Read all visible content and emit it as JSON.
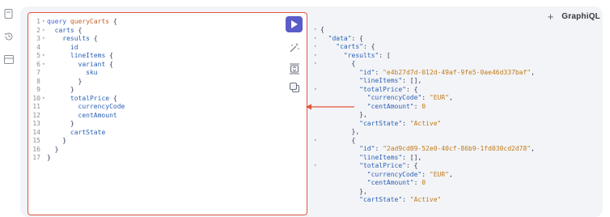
{
  "header": {
    "add_label": "+",
    "brand": "GraphiQL"
  },
  "sidebar": {
    "items": [
      {
        "icon": "file-icon"
      },
      {
        "icon": "history-icon"
      },
      {
        "icon": "explorer-icon"
      }
    ]
  },
  "toolbar": {
    "run_icon": "play-icon",
    "prettify_icon": "magic-wand-icon",
    "merge_icon": "merge-fragments-icon",
    "copy_icon": "copy-icon"
  },
  "editor": {
    "lines": [
      {
        "n": "1",
        "fold": "▾",
        "text": "query queryCarts {"
      },
      {
        "n": "2",
        "fold": "▾",
        "text": "  carts {"
      },
      {
        "n": "3",
        "fold": "▾",
        "text": "    results {"
      },
      {
        "n": "4",
        "fold": "",
        "text": "      id"
      },
      {
        "n": "5",
        "fold": "▾",
        "text": "      lineItems {"
      },
      {
        "n": "6",
        "fold": "▾",
        "text": "        variant {"
      },
      {
        "n": "7",
        "fold": "",
        "text": "          sku"
      },
      {
        "n": "8",
        "fold": "",
        "text": "        }"
      },
      {
        "n": "9",
        "fold": "",
        "text": "      }"
      },
      {
        "n": "10",
        "fold": "▾",
        "text": "      totalPrice {"
      },
      {
        "n": "11",
        "fold": "",
        "text": "        currencyCode"
      },
      {
        "n": "12",
        "fold": "",
        "text": "        centAmount"
      },
      {
        "n": "13",
        "fold": "",
        "text": "      }"
      },
      {
        "n": "14",
        "fold": "",
        "text": "      cartState"
      },
      {
        "n": "15",
        "fold": "",
        "text": "    }"
      },
      {
        "n": "16",
        "fold": "",
        "text": "  }"
      },
      {
        "n": "17",
        "fold": "",
        "text": "}"
      }
    ]
  },
  "result": {
    "lines": [
      {
        "fold": "▾",
        "text": "{"
      },
      {
        "fold": "▾",
        "text": "  \"data\": {"
      },
      {
        "fold": "▾",
        "text": "    \"carts\": {"
      },
      {
        "fold": "▾",
        "text": "      \"results\": ["
      },
      {
        "fold": "▾",
        "text": "        {"
      },
      {
        "fold": "",
        "text": "          \"id\": \"e4b27d7d-012d-49af-9fe5-0ae46d337baf\","
      },
      {
        "fold": "",
        "text": "          \"lineItems\": [],"
      },
      {
        "fold": "▾",
        "text": "          \"totalPrice\": {"
      },
      {
        "fold": "",
        "text": "            \"currencyCode\": \"EUR\","
      },
      {
        "fold": "",
        "text": "            \"centAmount\": 0"
      },
      {
        "fold": "",
        "text": "          },"
      },
      {
        "fold": "",
        "text": "          \"cartState\": \"Active\""
      },
      {
        "fold": "",
        "text": "        },"
      },
      {
        "fold": "▾",
        "text": "        {"
      },
      {
        "fold": "",
        "text": "          \"id\": \"2ad9cd89-52e0-40cf-86b9-1fd030cd2d78\","
      },
      {
        "fold": "",
        "text": "          \"lineItems\": [],"
      },
      {
        "fold": "▾",
        "text": "          \"totalPrice\": {"
      },
      {
        "fold": "",
        "text": "            \"currencyCode\": \"EUR\","
      },
      {
        "fold": "",
        "text": "            \"centAmount\": 0"
      },
      {
        "fold": "",
        "text": "          },"
      },
      {
        "fold": "",
        "text": "          \"cartState\": \"Active\""
      }
    ]
  },
  "colors": {
    "highlight": "#e2533b",
    "run": "#5a5cc8"
  }
}
